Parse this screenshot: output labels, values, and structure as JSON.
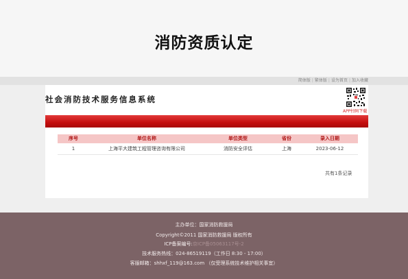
{
  "banner": {
    "title": "消防资质认定"
  },
  "util_links": [
    "简体版",
    "繁体版",
    "设为首页",
    "加入收藏"
  ],
  "header": {
    "system_title": "社会消防技术服务信息系统",
    "app_download": "APP扫码下载"
  },
  "table": {
    "columns": [
      "序号",
      "单位名称",
      "单位类型",
      "省份",
      "录入日期"
    ],
    "rows": [
      [
        "1",
        "上海平大建筑工程管理咨询有限公司",
        "消防安全评估",
        "上海",
        "2023-06-12"
      ]
    ]
  },
  "pager": {
    "text": "共有1条记录"
  },
  "footer": {
    "sponsor": "主办单位：国家消防救援局",
    "copyright": "Copyright©2011 国家消防救援局 版权所有",
    "icp_label": "ICP备案编号:",
    "icp_value": "京ICP备05063117号-2",
    "hotline": "技术服务热线：024-86519119（工作日 8:30 - 17:00）",
    "email": "客服邮箱：shhxf_119@163.com （仅受理系统技术维护相关事宜）"
  },
  "colors": {
    "accent_red": "#c40e0e",
    "footer_bg": "#7c6366",
    "header_row_bg": "#f5c6c6"
  }
}
